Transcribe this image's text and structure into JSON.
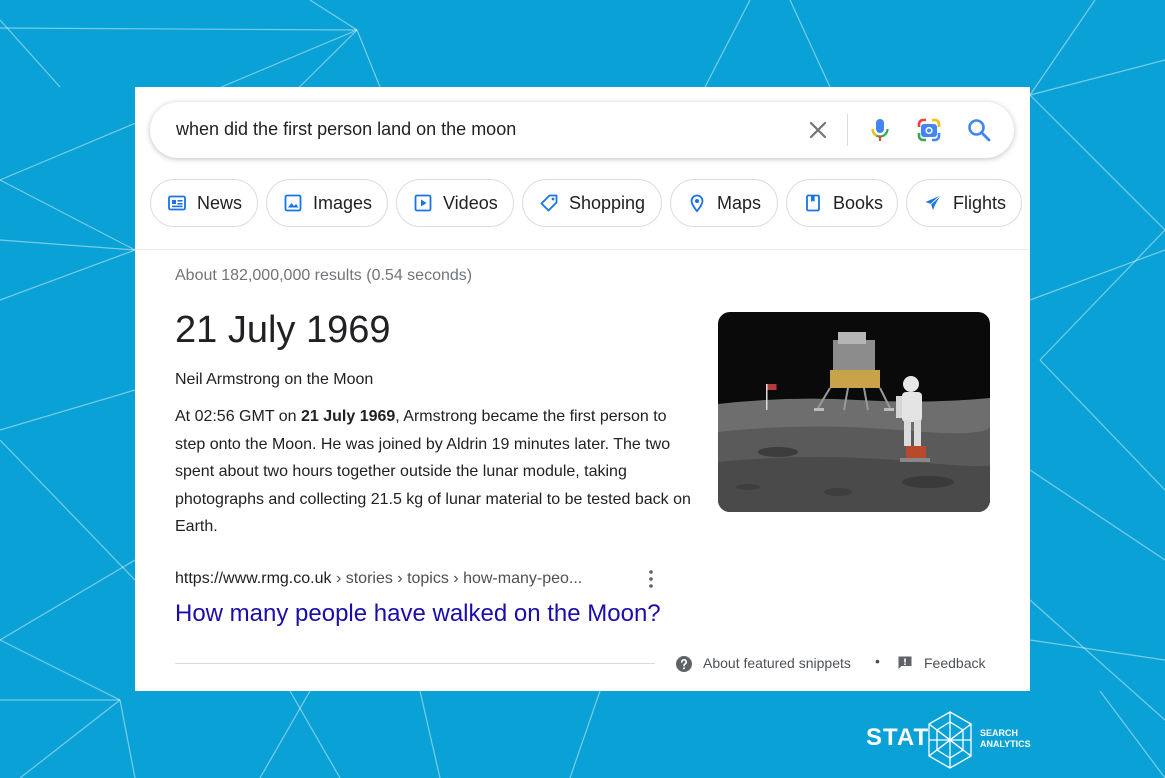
{
  "search": {
    "query": "when did the first person land on the moon"
  },
  "chips": [
    {
      "label": "News",
      "icon": "news-icon"
    },
    {
      "label": "Images",
      "icon": "image-icon"
    },
    {
      "label": "Videos",
      "icon": "video-icon"
    },
    {
      "label": "Shopping",
      "icon": "tag-icon"
    },
    {
      "label": "Maps",
      "icon": "map-pin-icon"
    },
    {
      "label": "Books",
      "icon": "book-icon"
    },
    {
      "label": "Flights",
      "icon": "airplane-icon"
    }
  ],
  "results": {
    "stats": "About 182,000,000 results (0.54 seconds)"
  },
  "featured_snippet": {
    "answer": "21 July 1969",
    "subtitle": "Neil Armstrong on the Moon",
    "text_before": "At 02:56 GMT on ",
    "text_bold": "21 July 1969",
    "text_after": ", Armstrong became the first person to step onto the Moon. He was joined by Aldrin 19 minutes later. The two spent about two hours together outside the lunar module, taking photographs and collecting 21.5 kg of lunar material to be tested back on Earth.",
    "cite_domain": "https://www.rmg.co.uk",
    "cite_path": " › stories › topics › how-many-peo...",
    "link_title": "How many people have walked on the Moon?",
    "about_label": "About featured snippets",
    "separator": "•",
    "feedback_label": "Feedback"
  },
  "branding": {
    "logo_word": "STAT",
    "tagline_line1": "SEARCH",
    "tagline_line2": "ANALYTICS"
  },
  "colors": {
    "background": "#0aa2d6",
    "link": "#1a0dab",
    "google_blue": "#4285f4",
    "google_red": "#ea4335",
    "google_yellow": "#fbbc04",
    "google_green": "#34a853"
  }
}
